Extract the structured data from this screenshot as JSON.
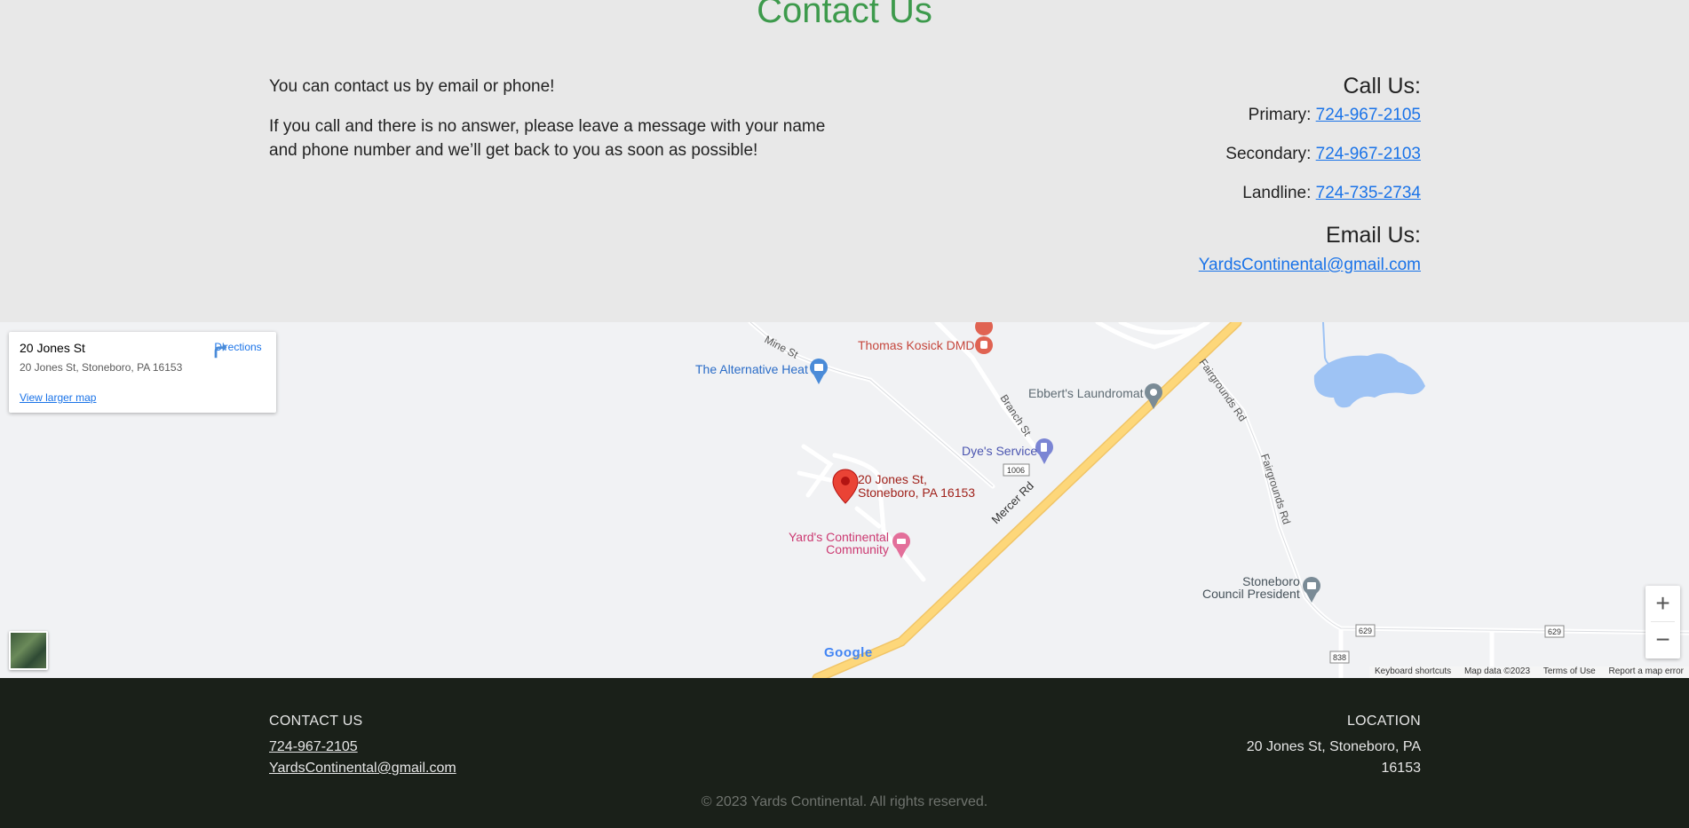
{
  "contact": {
    "title": "Contact Us",
    "intro_1": "You can contact us by email or phone!",
    "intro_2": "If you call and there is no answer, please leave a message with your name and phone number and we’ll get back to you as soon as possible!",
    "call_heading": "Call Us:",
    "phones": [
      {
        "label": "Primary: ",
        "number": "724-967-2105"
      },
      {
        "label": "Secondary: ",
        "number": "724-967-2103"
      },
      {
        "label": "Landline: ",
        "number": "724-735-2734"
      }
    ],
    "email_heading": "Email Us:",
    "email": "YardsContinental@gmail.com"
  },
  "map": {
    "card_title": "20 Jones St",
    "card_address": "20 Jones St, Stoneboro, PA 16153",
    "directions_label": "Directions",
    "larger_map_label": "View larger map",
    "pin_label_1": "20 Jones St,",
    "pin_label_2": "Stoneboro, PA 16153",
    "places": {
      "kosick": "Thomas Kosick DMD",
      "alternative": "The Alternative Heat",
      "laundromat": "Ebbert's Laundromat",
      "dyes": "Dye's Service",
      "yards_1": "Yard's Continental",
      "yards_2": "Community",
      "council_1": "Stoneboro",
      "council_2": "Council President"
    },
    "roads": {
      "mine": "Mine St",
      "branch": "Branch St",
      "mercer": "Mercer Rd",
      "fairgrounds_1": "Fairgrounds Rd",
      "fairgrounds_2": "Fairgrounds Rd",
      "route_1006": "1006",
      "route_629a": "629",
      "route_629b": "629",
      "route_838": "838"
    },
    "logo": "Google",
    "footer": {
      "shortcuts": "Keyboard shortcuts",
      "data": "Map data ©2023",
      "terms": "Terms of Use",
      "report": "Report a map error"
    },
    "zoom_in": "+",
    "zoom_out": "−"
  },
  "footer": {
    "contact_heading": "CONTACT US",
    "phone": "724-967-2105",
    "email": "YardsContinental@gmail.com",
    "location_heading": "LOCATION",
    "address": "20 Jones St, Stoneboro, PA 16153",
    "copyright": "© 2023 Yards Continental. All rights reserved."
  },
  "colors": {
    "title_green": "#3d9a4c",
    "link_blue": "#1a73e8",
    "footer_bg": "#1a2019",
    "pin_red": "#ea4335",
    "road_yellow": "#fdd77a"
  }
}
